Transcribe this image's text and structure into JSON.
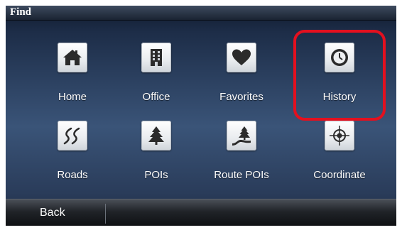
{
  "title": "Find",
  "items": [
    {
      "label": "Home",
      "icon": "home-icon"
    },
    {
      "label": "Office",
      "icon": "office-building-icon"
    },
    {
      "label": "Favorites",
      "icon": "heart-icon"
    },
    {
      "label": "History",
      "icon": "clock-icon"
    },
    {
      "label": "Roads",
      "icon": "road-icon"
    },
    {
      "label": "POIs",
      "icon": "tree-icon"
    },
    {
      "label": "Route POIs",
      "icon": "route-tree-icon"
    },
    {
      "label": "Coordinate",
      "icon": "crosshair-icon"
    }
  ],
  "back_label": "Back",
  "highlighted_item": "History",
  "colors": {
    "highlight": "#e3101f",
    "icon": "#2b2b2b",
    "text": "#ffffff"
  }
}
